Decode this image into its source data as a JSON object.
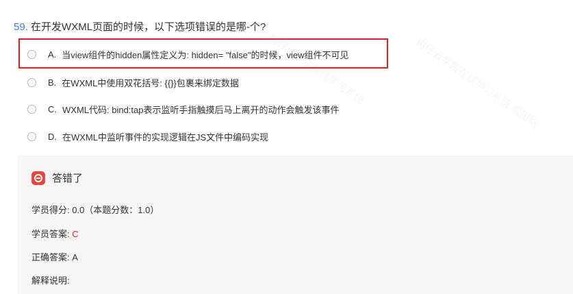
{
  "question": {
    "number": "59.",
    "text": "在开发WXML页面的时候，以下选项错误的是哪-个?"
  },
  "options": [
    {
      "letter": "A.",
      "text": "当view组件的hidden属性定义为: hidden= \"false\"的时候，view组件不可见"
    },
    {
      "letter": "B.",
      "text": "在WXML中使用双花括号: {{}}包裹来绑定数据"
    },
    {
      "letter": "C.",
      "text": "WXML代码: bind:tap表示监听手指触摸后马上离开的动作会触发该事件"
    },
    {
      "letter": "D.",
      "text": "在WXML中监听事件的实现逻辑在JS文件中编码实现"
    }
  ],
  "result": {
    "icon": "wrong-answer-icon",
    "title": "答错了",
    "score_label": "学员得分: ",
    "score_value": "0.0（本题分数：1.0）",
    "student_answer_label": "学员答案: ",
    "student_answer_value": "C",
    "correct_answer_label": "正确答案: ",
    "correct_answer_value": "A",
    "explanation_label": "解释说明: "
  },
  "watermark": {
    "text_1": "树仔云学院在线学习系统",
    "text_2": "树仔云学院在线学习系统 福田路"
  },
  "colors": {
    "question_number": "#3a7bd5",
    "highlight_border": "#e02020",
    "wrong_icon": "#e8453c",
    "student_answer": "#e02020",
    "panel_bg": "#f6f6f6"
  }
}
